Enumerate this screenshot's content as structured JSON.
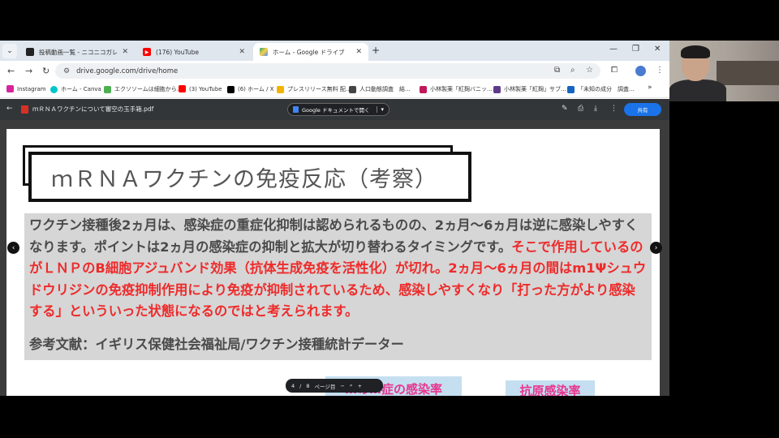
{
  "tabs": [
    {
      "title": "投稿動画一覧 - ニコニコガレージ",
      "favicon_color": "#222222"
    },
    {
      "title": "(176) YouTube",
      "favicon_color": "#ff0000"
    },
    {
      "title": "ホーム - Google ドライブ",
      "favicon_color": "#1fa463"
    }
  ],
  "address": {
    "url": "drive.google.com/drive/home"
  },
  "bookmarks": [
    {
      "label": "Instagram",
      "color": "#d6249f"
    },
    {
      "label": "ホーム - Canva",
      "color": "#00c4cc"
    },
    {
      "label": "エクソソームは細胞から...",
      "color": "#4caf50"
    },
    {
      "label": "(3) YouTube",
      "color": "#ff0000"
    },
    {
      "label": "(6) ホーム / X",
      "color": "#000000"
    },
    {
      "label": "プレスリリース無料 配...",
      "color": "#f2b400"
    },
    {
      "label": "人口動態調査　結...",
      "color": "#444444"
    },
    {
      "label": "小林製薬「紅麹バニッ...",
      "color": "#c2185b"
    },
    {
      "label": "小林製薬「紅麹」サブ...",
      "color": "#5e3b8a"
    },
    {
      "label": "「未知の成分　調査...",
      "color": "#1565c0"
    }
  ],
  "viewer": {
    "file_name": "ｍＲＮＡワクチンについて審空の玉手箱.pdf",
    "open_with_label": "Google ドキュメントで開く",
    "share_label": "共有"
  },
  "slide": {
    "title": "ｍＲＮＡワクチンの免疫反応（考察）",
    "para_gray": "ワクチン接種後2ヵ月は、感染症の重症化抑制は認められるものの、2ヵ月〜6ヵ月は逆に感染しやすくなります。ポイントは2ヵ月の感染症の抑制と拡大が切り替わるタイミングです。",
    "para_red": "そこで作用しているのがＬＮＰのB細胞アジュバンド効果（抗体生成免疫を活性化）が切れ。2ヵ月〜6ヵ月の間はm1Ψシュウドウリジンの免疫抑制作用により免疫が抑制されているため、感染しやすくなり「打った方がより感染する」といういった状態になるのではと考えられます。",
    "reference": "参考文献：イギリス保健社会福祉局/ワクチン接種統計データー",
    "bottom_label_1": "…の…症の感染率",
    "bottom_label_2": "抗原感染率"
  },
  "page_control": {
    "current": "4",
    "separator": "/",
    "total": "8",
    "page_label": "ページ目"
  }
}
